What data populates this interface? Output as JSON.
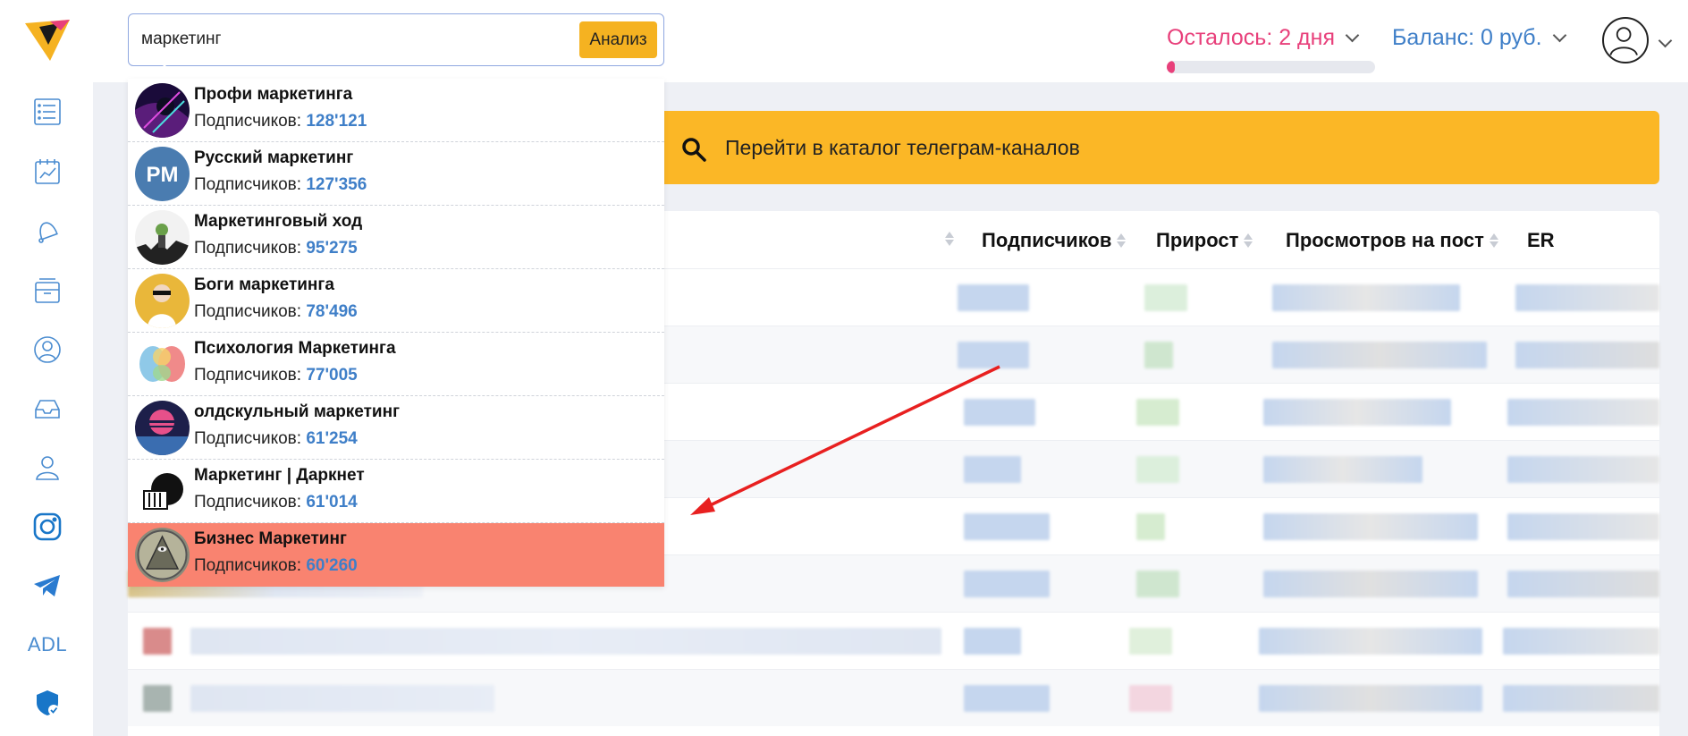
{
  "colors": {
    "accent_yellow": "#fbb726",
    "pink": "#e8407b",
    "blue": "#3f7fc8",
    "selected_row": "#f98370",
    "arrow": "#e82020"
  },
  "sidebar": {
    "logo": "app-logo",
    "items": [
      {
        "name": "list-icon"
      },
      {
        "name": "report-icon"
      },
      {
        "name": "bell-icon"
      },
      {
        "name": "archive-icon"
      },
      {
        "name": "agent-icon"
      },
      {
        "name": "inbox-icon"
      },
      {
        "name": "users-icon"
      },
      {
        "name": "instagram-icon"
      },
      {
        "name": "telegram-icon"
      },
      {
        "name": "adl",
        "label": "ADL"
      },
      {
        "name": "shield-check-icon"
      }
    ]
  },
  "header": {
    "search": {
      "value": "маркетинг",
      "button_label": "Анализ"
    },
    "remaining_label": "Осталось: 2 дня",
    "balance_label": "Баланс: 0 руб.",
    "remaining_progress_pct": 4
  },
  "catalog": {
    "label": "Перейти в каталог телеграм-каналов"
  },
  "table": {
    "columns": [
      "Подписчиков",
      "Прирост",
      "Просмотров на пост",
      "ER"
    ]
  },
  "dropdown": {
    "subs_label": "Подписчиков:",
    "items": [
      {
        "name": "Профи маркетинга",
        "subs": "128'121"
      },
      {
        "name": "Русский маркетинг",
        "subs": "127'356"
      },
      {
        "name": "Маркетинговый ход",
        "subs": "95'275"
      },
      {
        "name": "Боги маркетинга",
        "subs": "78'496"
      },
      {
        "name": "Психология Маркетинга",
        "subs": "77'005"
      },
      {
        "name": "олдскульный маркетинг",
        "subs": "61'254"
      },
      {
        "name": "Маркетинг | Даркнет",
        "subs": "61'014"
      },
      {
        "name": "Бизнес Маркетинг",
        "subs": "60'260",
        "selected": true
      }
    ],
    "avatar_texts": {
      "russian_marketing": "PM"
    }
  }
}
